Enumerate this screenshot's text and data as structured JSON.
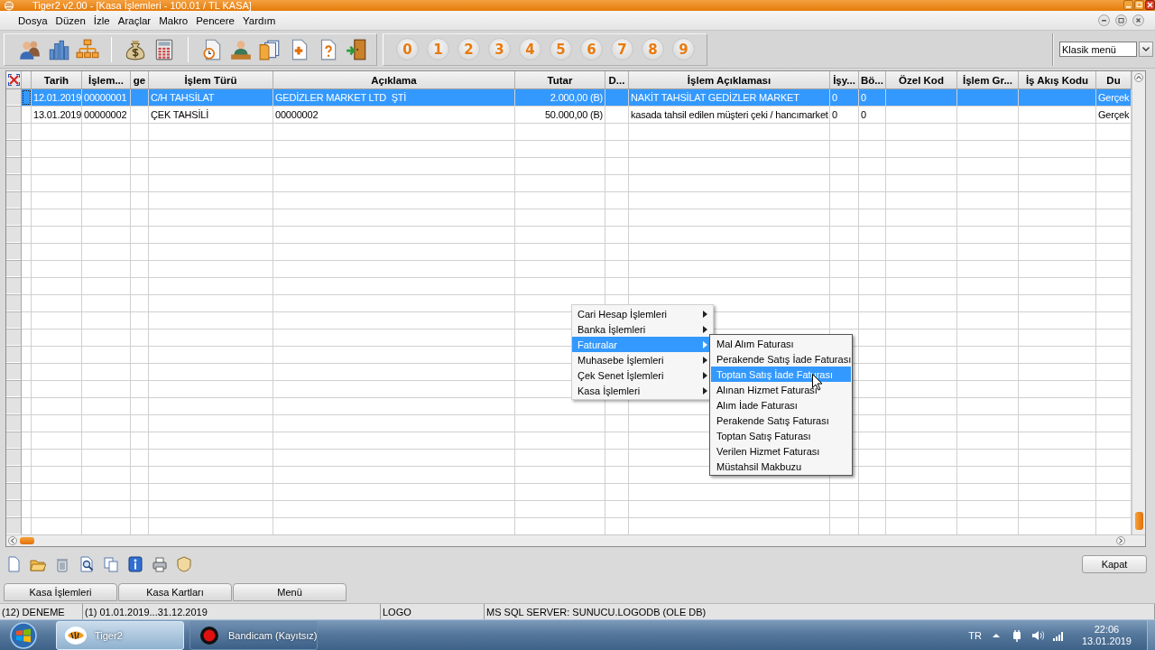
{
  "window": {
    "title": "Tiger2 v2.00 - [Kasa İşlemleri - 100.01 / TL KASA]"
  },
  "menu_bar": [
    "Dosya",
    "Düzen",
    "İzle",
    "Araçlar",
    "Makro",
    "Pencere",
    "Yardım"
  ],
  "toolbar": {
    "number_buttons": [
      "0",
      "1",
      "2",
      "3",
      "4",
      "5",
      "6",
      "7",
      "8",
      "9"
    ],
    "menu_style": {
      "value": "Klasik menü"
    }
  },
  "table": {
    "columns": [
      {
        "label": "Tarih"
      },
      {
        "label": "İşlem..."
      },
      {
        "label": "ge"
      },
      {
        "label": "İşlem Türü"
      },
      {
        "label": "Açıklama"
      },
      {
        "label": "Tutar"
      },
      {
        "label": "D..."
      },
      {
        "label": "İşlem Açıklaması"
      },
      {
        "label": "İşy..."
      },
      {
        "label": "Bö..."
      },
      {
        "label": "Özel Kod"
      },
      {
        "label": "İşlem Gr..."
      },
      {
        "label": "İş Akış Kodu"
      },
      {
        "label": "Du"
      }
    ],
    "rows": [
      {
        "selected": true,
        "cells": {
          "tarih": "12.01.2019",
          "column_2": "00000001",
          "islem_turu": "C/H TAHSİLAT",
          "aciklama": "GEDİZLER MARKET LTD  ŞTİ",
          "tutar": "2.000,00 (B)",
          "islem_aciklamasi": "NAKİT TAHSİLAT GEDİZLER MARKET",
          "column_9": "0",
          "column_10": "0",
          "column_14": "Gerçek"
        }
      },
      {
        "selected": false,
        "cells": {
          "tarih": "13.01.2019",
          "column_2": "00000002",
          "islem_turu": "ÇEK TAHSİLİ",
          "aciklama": "00000002",
          "tutar": "50.000,00 (B)",
          "islem_aciklamasi": "kasada tahsil edilen müşteri çeki / hancımarket",
          "column_9": "0",
          "column_10": "0",
          "column_14": "Gerçek"
        }
      }
    ]
  },
  "context_menu": {
    "items": [
      {
        "label": "Cari Hesap İşlemleri",
        "submenu": true,
        "selected": false
      },
      {
        "label": "Banka İşlemleri",
        "submenu": true,
        "selected": false
      },
      {
        "label": "Faturalar",
        "submenu": true,
        "selected": true
      },
      {
        "label": "Muhasebe İşlemleri",
        "submenu": true,
        "selected": false
      },
      {
        "label": "Çek Senet İşlemleri",
        "submenu": true,
        "selected": false
      },
      {
        "label": "Kasa İşlemleri",
        "submenu": true,
        "selected": false
      }
    ],
    "submenu": {
      "items": [
        {
          "label": "Mal Alım Faturası",
          "selected": false
        },
        {
          "label": "Perakende Satış İade Faturası",
          "selected": false
        },
        {
          "label": "Toptan Satış İade Faturası",
          "selected": true
        },
        {
          "label": "Alınan Hizmet Faturası",
          "selected": false
        },
        {
          "label": "Alım İade Faturası",
          "selected": false
        },
        {
          "label": "Perakende Satış Faturası",
          "selected": false
        },
        {
          "label": "Toptan Satış Faturası",
          "selected": false
        },
        {
          "label": "Verilen Hizmet Faturası",
          "selected": false
        },
        {
          "label": "Müstahsil Makbuzu",
          "selected": false
        }
      ]
    }
  },
  "bottom_toolbar": {
    "close_button": "Kapat"
  },
  "tabs": [
    {
      "label": "Kasa İşlemleri"
    },
    {
      "label": "Kasa Kartları"
    },
    {
      "label": "Menü"
    }
  ],
  "status_bar": [
    "(12) DENEME",
    "(1) 01.01.2019...31.12.2019",
    "LOGO",
    "MS SQL SERVER: SUNUCU.LOGODB (OLE DB)"
  ],
  "taskbar": {
    "items": [
      {
        "label": "Tiger2",
        "selected": true
      },
      {
        "label": "Bandicam (Kayıtsız)",
        "selected": false
      }
    ],
    "language": "TR",
    "time": "22:06",
    "date": "13.01.2019"
  }
}
